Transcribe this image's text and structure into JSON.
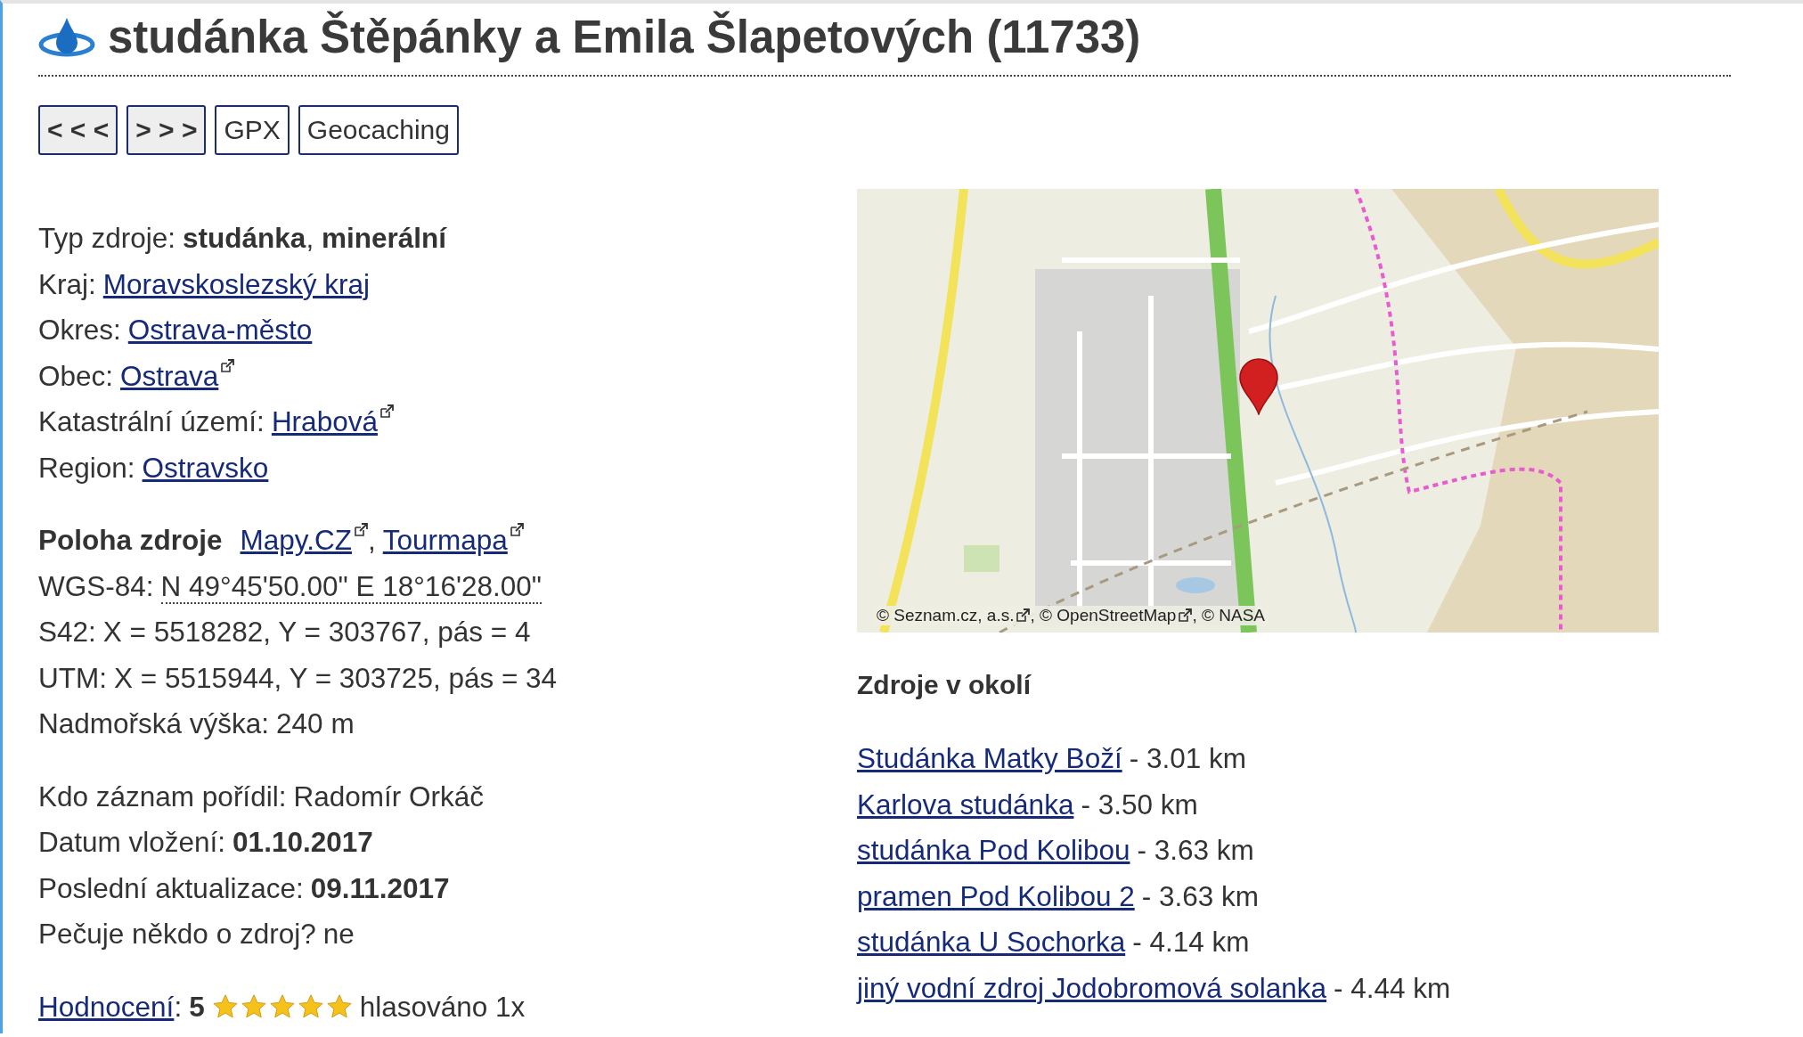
{
  "title": "studánka Štěpánky a Emila Šlapetových (11733)",
  "buttons": [
    {
      "label": "< < <",
      "kind": "nav"
    },
    {
      "label": "> > >",
      "kind": "nav"
    },
    {
      "label": "GPX",
      "kind": "export"
    },
    {
      "label": "Geocaching",
      "kind": "export"
    }
  ],
  "details": [
    {
      "label": "Typ zdroje:",
      "value": "**studánka**, **minerální**"
    },
    {
      "label": "Kraj:",
      "link": "Moravskoslezský kraj",
      "external": false
    },
    {
      "label": "Okres:",
      "link": "Ostrava-město",
      "external": false
    },
    {
      "label": "Obec:",
      "link": "Ostrava",
      "external": true
    },
    {
      "label": "Katastrální území:",
      "link": "Hrabová",
      "external": true
    },
    {
      "label": "Region:",
      "link": "Ostravsko",
      "external": false
    }
  ],
  "position": {
    "heading": "Poloha zdroje",
    "separator": ",",
    "links": [
      {
        "text": "Mapy.CZ",
        "external": true
      },
      {
        "text": "Tourmapa",
        "external": true
      }
    ],
    "lines": [
      {
        "label": "WGS-84:",
        "value": "N 49°45'50.00\" E 18°16'28.00\"",
        "kind": "abbr"
      },
      {
        "label": "S42:",
        "value": "X = 5518282, Y = 303767, pás = 4",
        "kind": "plain"
      },
      {
        "label": "UTM:",
        "value": "X = 5515944, Y = 303725, pás = 34",
        "kind": "plain"
      },
      {
        "label": "Nadmořská výška:",
        "value": "240 m",
        "kind": "plain"
      }
    ]
  },
  "record": [
    {
      "label": "Kdo záznam pořídil:",
      "value": "Radomír Orkáč",
      "bold": false
    },
    {
      "label": "Datum vložení:",
      "value": "01.10.2017",
      "bold": true
    },
    {
      "label": "Poslední aktualizace:",
      "value": "09.11.2017",
      "bold": true
    },
    {
      "label": "Pečuje někdo o zdroj?",
      "value": "ne",
      "bold": false
    }
  ],
  "rating": {
    "link": "Hodnocení",
    "separator": ":",
    "score": "5",
    "stars": 5,
    "votes": "hlasováno 1x"
  },
  "map": {
    "kind": "picture",
    "attribution": [
      {
        "text": "© Seznam.cz, a.s.",
        "external": true
      },
      {
        "text": ", © OpenStreetMap",
        "external": true
      },
      {
        "text": ", © NASA",
        "external": false
      }
    ]
  },
  "nearby": {
    "heading": "Zdroje v okolí",
    "items": [
      {
        "name": "Studánka Matky Boží",
        "distance": "- 3.01 km"
      },
      {
        "name": "Karlova studánka",
        "distance": "- 3.50 km"
      },
      {
        "name": "studánka Pod Kolibou",
        "distance": "- 3.63 km"
      },
      {
        "name": "pramen Pod Kolibou 2",
        "distance": "- 3.63 km"
      },
      {
        "name": "studánka U Sochorka",
        "distance": "- 4.14 km"
      },
      {
        "name": "jiný vodní zdroj Jodobromová solanka",
        "distance": "- 4.44 km"
      }
    ]
  }
}
